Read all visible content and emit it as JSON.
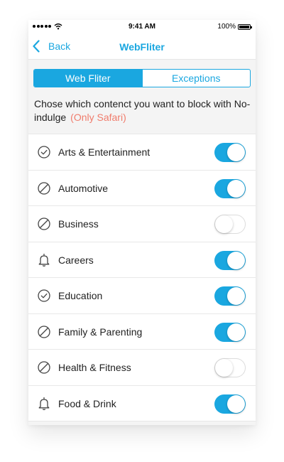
{
  "status_bar": {
    "time": "9:41 AM",
    "battery": "100%"
  },
  "nav": {
    "back_label": "Back",
    "title": "WebFliter"
  },
  "segments": {
    "active": "Web Fliter",
    "inactive": "Exceptions"
  },
  "description": {
    "text": "Chose which contenct you want to block with No-indulge",
    "note": "(Only Safari)"
  },
  "colors": {
    "accent": "#1aa7e0",
    "note": "#f07c6c"
  },
  "categories": [
    {
      "label": "Arts & Entertainment",
      "icon": "check-circle-icon",
      "enabled": true
    },
    {
      "label": "Automotive",
      "icon": "slash-circle-icon",
      "enabled": true
    },
    {
      "label": "Business",
      "icon": "slash-circle-icon",
      "enabled": false
    },
    {
      "label": "Careers",
      "icon": "bell-icon",
      "enabled": true
    },
    {
      "label": "Education",
      "icon": "check-circle-icon",
      "enabled": true
    },
    {
      "label": "Family & Parenting",
      "icon": "slash-circle-icon",
      "enabled": true
    },
    {
      "label": "Health & Fitness",
      "icon": "slash-circle-icon",
      "enabled": false
    },
    {
      "label": "Food & Drink",
      "icon": "bell-icon",
      "enabled": true
    }
  ]
}
